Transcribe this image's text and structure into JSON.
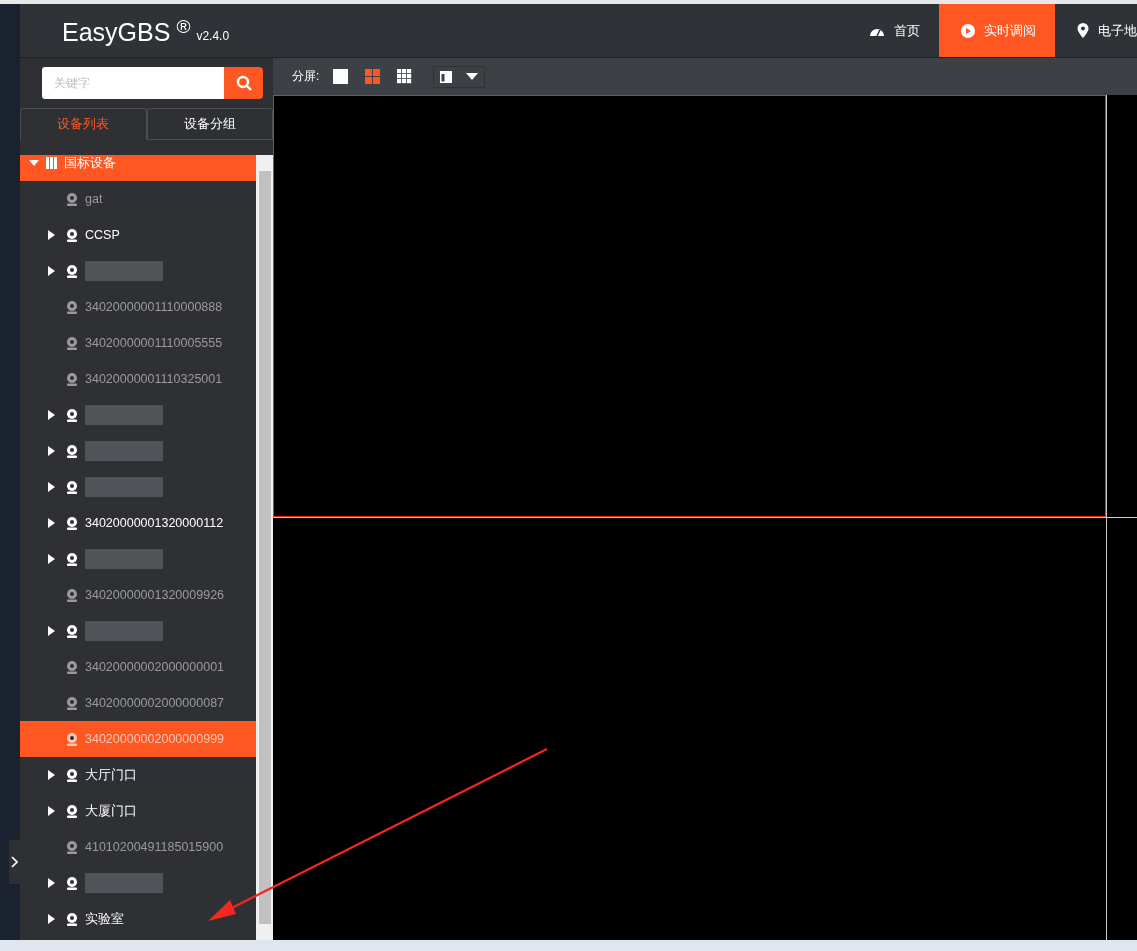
{
  "header": {
    "logo": "EasyGBS",
    "registered": "®",
    "version": "v2.4.0",
    "nav": [
      {
        "label": "首页",
        "selected": false
      },
      {
        "label": "实时调阅",
        "selected": true
      },
      {
        "label": "电子地",
        "selected": false
      }
    ]
  },
  "sidebar": {
    "search": {
      "placeholder": "关键字"
    },
    "tabs": [
      {
        "label": "设备列表",
        "selected": true
      },
      {
        "label": "设备分组",
        "selected": false
      }
    ],
    "tree": [
      {
        "name": "国标设备",
        "kind": "root",
        "expanded": true,
        "children": [
          {
            "name": "gat",
            "kind": "leaf",
            "selected": false
          },
          {
            "name": "CCSP",
            "kind": "group",
            "selected": false
          },
          {
            "kind": "blurred",
            "selected": false
          },
          {
            "name": "34020000001110000888",
            "kind": "leaf",
            "selected": false
          },
          {
            "name": "34020000001110005555",
            "kind": "leaf",
            "selected": false
          },
          {
            "name": "34020000001110325001",
            "kind": "leaf",
            "selected": false
          },
          {
            "kind": "blurred",
            "selected": false
          },
          {
            "kind": "blurred",
            "selected": false
          },
          {
            "kind": "blurred",
            "selected": false
          },
          {
            "name": "34020000001320000112",
            "kind": "group",
            "selected": false
          },
          {
            "kind": "blurred",
            "selected": false
          },
          {
            "name": "34020000001320009926",
            "kind": "leaf",
            "selected": false
          },
          {
            "kind": "blurred",
            "selected": false
          },
          {
            "name": "34020000002000000001",
            "kind": "leaf",
            "selected": false
          },
          {
            "name": "34020000002000000087",
            "kind": "leaf",
            "selected": false
          },
          {
            "name": "34020000002000000999",
            "kind": "leaf",
            "selected": true
          },
          {
            "name": "大厅门口",
            "kind": "group",
            "selected": false
          },
          {
            "name": "大厦门口",
            "kind": "group",
            "selected": false
          },
          {
            "name": "41010200491185015900",
            "kind": "leaf",
            "selected": false
          },
          {
            "kind": "blurred",
            "selected": false
          },
          {
            "name": "实验室",
            "kind": "group",
            "selected": false
          }
        ]
      }
    ]
  },
  "toolbar": {
    "label": "分屏:",
    "splits": [
      {
        "selected": false
      },
      {
        "selected": true
      },
      {
        "selected": false
      }
    ]
  },
  "video": {
    "cells": [
      {
        "selected": true
      },
      {
        "selected": false
      },
      {
        "selected": false
      },
      {
        "selected": false
      }
    ]
  }
}
